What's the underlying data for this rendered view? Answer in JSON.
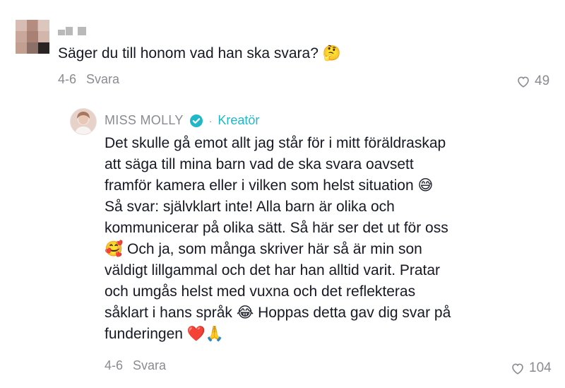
{
  "comment": {
    "username_hidden": true,
    "text": "Säger du till honom vad han ska svara? 🤔",
    "date": "4-6",
    "reply_label": "Svara",
    "likes": "49"
  },
  "reply": {
    "author": "MISS MOLLY",
    "badge_label": "Kreatör",
    "lines": [
      "Det skulle gå emot allt jag står för i mitt föräldraskap",
      "att säga till mina barn vad de ska svara oavsett",
      "framför kamera eller i vilken som helst situation 😅",
      "Så svar: självklart inte! Alla barn är olika och",
      "kommunicerar på olika sätt. Så här ser det ut för oss",
      "🥰 Och ja, som många skriver här så är min son",
      "väldigt lillgammal och det har han alltid varit. Pratar",
      "och umgås helst med vuxna och det reflekteras",
      "såklart i hans språk 😂 Hoppas detta gav dig svar på",
      "funderingen ❤️🙏"
    ],
    "date": "4-6",
    "reply_label": "Svara",
    "likes": "104"
  },
  "icons": {
    "like": "heart-outline-icon",
    "verified": "verified-check-icon"
  },
  "colors": {
    "text": "#161823",
    "muted": "#8a8b91",
    "verified": "#20b8c8"
  }
}
